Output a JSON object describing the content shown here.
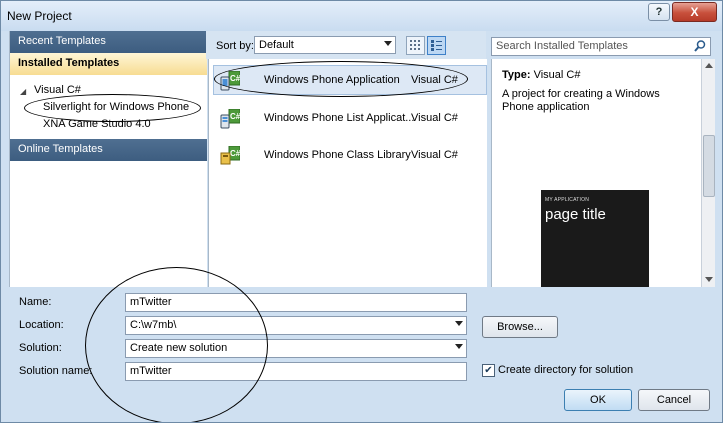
{
  "window": {
    "title": "New Project",
    "help_label": "?",
    "close_label": "X"
  },
  "sidebar": {
    "recent_label": "Recent Templates",
    "installed_label": "Installed Templates",
    "tree": [
      {
        "label": "Visual C#"
      },
      {
        "label": "Silverlight for Windows Phone"
      },
      {
        "label": "XNA Game Studio 4.0"
      }
    ],
    "online_label": "Online Templates"
  },
  "toolbar": {
    "sort_label": "Sort by:",
    "sort_value": "Default"
  },
  "templates": [
    {
      "name": "Windows Phone Application",
      "lang": "Visual C#"
    },
    {
      "name": "Windows Phone List Applicat...",
      "lang": "Visual C#"
    },
    {
      "name": "Windows Phone Class Library",
      "lang": "Visual C#"
    }
  ],
  "search": {
    "placeholder": "Search Installed Templates"
  },
  "details": {
    "type_label": "Type:",
    "type_value": "Visual C#",
    "description": "A project for creating a Windows Phone application",
    "preview_app": "MY APPLICATION",
    "preview_title": "page title"
  },
  "form": {
    "name_label": "Name:",
    "name_value": "mTwitter",
    "location_label": "Location:",
    "location_value": "C:\\w7mb\\",
    "browse_label": "Browse...",
    "solution_label": "Solution:",
    "solution_value": "Create new solution",
    "solution_name_label": "Solution name:",
    "solution_name_value": "mTwitter",
    "create_dir_label": "Create directory for solution",
    "create_dir_checked": true,
    "ok_label": "OK",
    "cancel_label": "Cancel"
  },
  "colors": {
    "sidebar_header": "#4f6f91",
    "selection": "#f7dc92",
    "dialog_bg": "#cfe0f1"
  }
}
